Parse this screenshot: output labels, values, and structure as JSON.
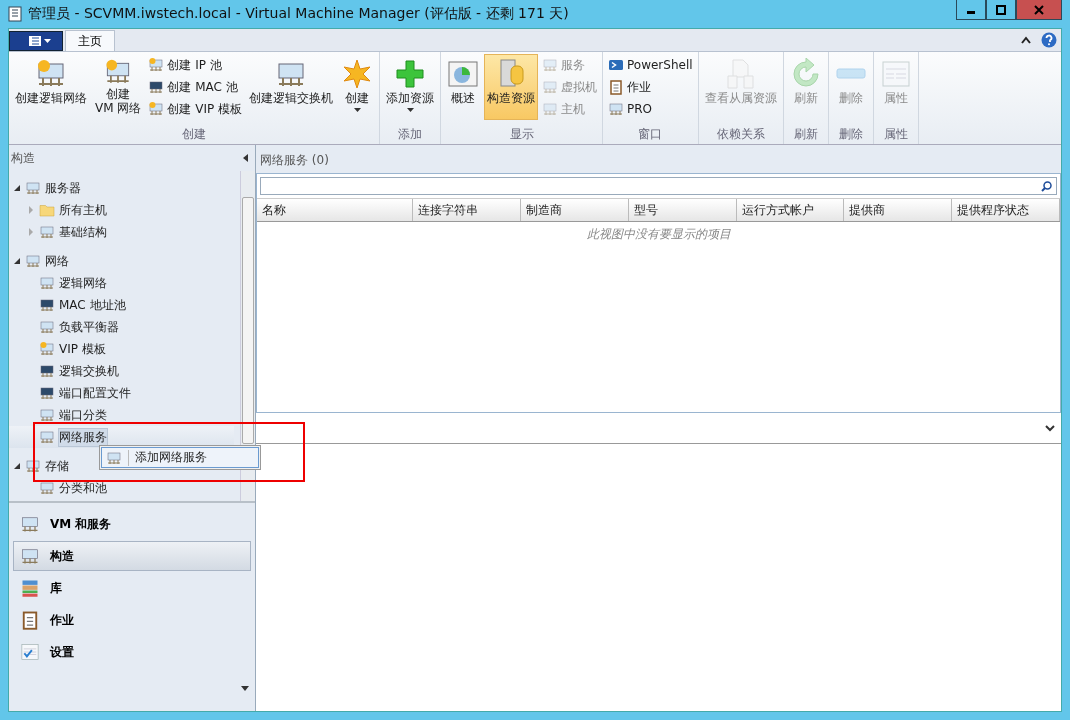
{
  "window": {
    "title": "管理员 - SCVMM.iwstech.local - Virtual Machine Manager (评估版 - 还剩 171 天)"
  },
  "tabs": [
    {
      "label": "主页",
      "selected": true
    }
  ],
  "ribbon": {
    "groups": [
      {
        "label": "创建",
        "items": [
          {
            "kind": "large",
            "label": "创建逻辑网络",
            "disabled": false,
            "selected": false,
            "dropdown": false
          },
          {
            "kind": "large",
            "label": "创建\nVM 网络",
            "disabled": false,
            "selected": false,
            "dropdown": false
          },
          {
            "kind": "stack",
            "items": [
              {
                "label": "创建 IP 池",
                "disabled": false
              },
              {
                "label": "创建 MAC 池",
                "disabled": false
              },
              {
                "label": "创建 VIP 模板",
                "disabled": false
              }
            ]
          },
          {
            "kind": "large",
            "label": "创建逻辑交换机",
            "disabled": false,
            "selected": false,
            "dropdown": false
          },
          {
            "kind": "large",
            "label": "创建",
            "disabled": false,
            "selected": false,
            "dropdown": true
          }
        ]
      },
      {
        "label": "添加",
        "items": [
          {
            "kind": "large",
            "label": "添加资源",
            "disabled": false,
            "selected": false,
            "dropdown": true
          }
        ]
      },
      {
        "label": "显示",
        "items": [
          {
            "kind": "large",
            "label": "概述",
            "disabled": false,
            "selected": false,
            "dropdown": false
          },
          {
            "kind": "large",
            "label": "构造资源",
            "disabled": false,
            "selected": true,
            "dropdown": false
          },
          {
            "kind": "stack",
            "items": [
              {
                "label": "服务",
                "disabled": true
              },
              {
                "label": "虚拟机",
                "disabled": true
              },
              {
                "label": "主机",
                "disabled": true
              }
            ]
          }
        ]
      },
      {
        "label": "窗口",
        "items": [
          {
            "kind": "stack",
            "items": [
              {
                "label": "PowerShell",
                "disabled": false
              },
              {
                "label": "作业",
                "disabled": false
              },
              {
                "label": "PRO",
                "disabled": false
              }
            ]
          }
        ]
      },
      {
        "label": "依赖关系",
        "items": [
          {
            "kind": "large",
            "label": "查看从属资源",
            "disabled": true,
            "selected": false,
            "dropdown": false
          }
        ]
      },
      {
        "label": "刷新",
        "items": [
          {
            "kind": "large",
            "label": "刷新",
            "disabled": true,
            "selected": false,
            "dropdown": false
          }
        ]
      },
      {
        "label": "删除",
        "items": [
          {
            "kind": "large",
            "label": "删除",
            "disabled": true,
            "selected": false,
            "dropdown": false
          }
        ]
      },
      {
        "label": "属性",
        "items": [
          {
            "kind": "large",
            "label": "属性",
            "disabled": true,
            "selected": false,
            "dropdown": false
          }
        ]
      }
    ]
  },
  "sidebar": {
    "title": "构造",
    "tree": [
      {
        "label": "服务器",
        "expanded": true,
        "selected": false,
        "children": [
          {
            "label": "所有主机",
            "expanded": false,
            "selected": false
          },
          {
            "label": "基础结构",
            "expanded": false,
            "selected": false
          }
        ]
      },
      {
        "label": "网络",
        "expanded": true,
        "selected": false,
        "children": [
          {
            "label": "逻辑网络",
            "selected": false
          },
          {
            "label": "MAC 地址池",
            "selected": false
          },
          {
            "label": "负载平衡器",
            "selected": false
          },
          {
            "label": "VIP 模板",
            "selected": false
          },
          {
            "label": "逻辑交换机",
            "selected": false
          },
          {
            "label": "端口配置文件",
            "selected": false
          },
          {
            "label": "端口分类",
            "selected": false
          },
          {
            "label": "网络服务",
            "selected": true
          }
        ]
      },
      {
        "label": "存储",
        "expanded": true,
        "selected": false,
        "children": [
          {
            "label": "分类和池",
            "selected": false
          }
        ]
      }
    ],
    "context_menu": {
      "items": [
        "添加网络服务"
      ]
    },
    "nav": [
      {
        "label": "VM 和服务",
        "selected": false
      },
      {
        "label": "构造",
        "selected": true
      },
      {
        "label": "库",
        "selected": false
      },
      {
        "label": "作业",
        "selected": false
      },
      {
        "label": "设置",
        "selected": false
      }
    ]
  },
  "content": {
    "title": "网络服务 (0)",
    "columns": [
      "名称",
      "连接字符串",
      "制造商",
      "型号",
      "运行方式帐户",
      "提供商",
      "提供程序状态"
    ],
    "empty_message": "此视图中没有要显示的项目"
  }
}
